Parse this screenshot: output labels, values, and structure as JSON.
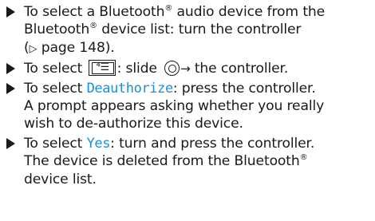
{
  "steps": [
    {
      "line1_a": "To select a Bluetooth",
      "line1_sup": "®",
      "line1_b": " audio device from the",
      "line2_a": "Bluetooth",
      "line2_sup": "®",
      "line2_b": " device list: turn the controller",
      "line3_open": "(",
      "line3_ref": "▷",
      "line3_b": " page 148)."
    },
    {
      "text_a": "To select ",
      "text_b": ": slide ",
      "text_c": " the controller.",
      "arrow": "→"
    },
    {
      "text_a": "To select ",
      "highlight": "Deauthorize",
      "text_b": ": press the controller.",
      "line2": "A prompt appears asking whether you really",
      "line3": "wish to de-authorize this device."
    },
    {
      "text_a": "To select ",
      "highlight": "Yes",
      "text_b": ": turn and press the controller.",
      "line2_a": "The device is deleted from the Bluetooth",
      "line2_sup": "®",
      "line3": "device list."
    }
  ],
  "icons": {
    "bullet": "triangle-bullet-icon",
    "menu": "menu-button-icon",
    "controller": "controller-knob-icon"
  },
  "colors": {
    "highlight": "#1b8fd6"
  }
}
